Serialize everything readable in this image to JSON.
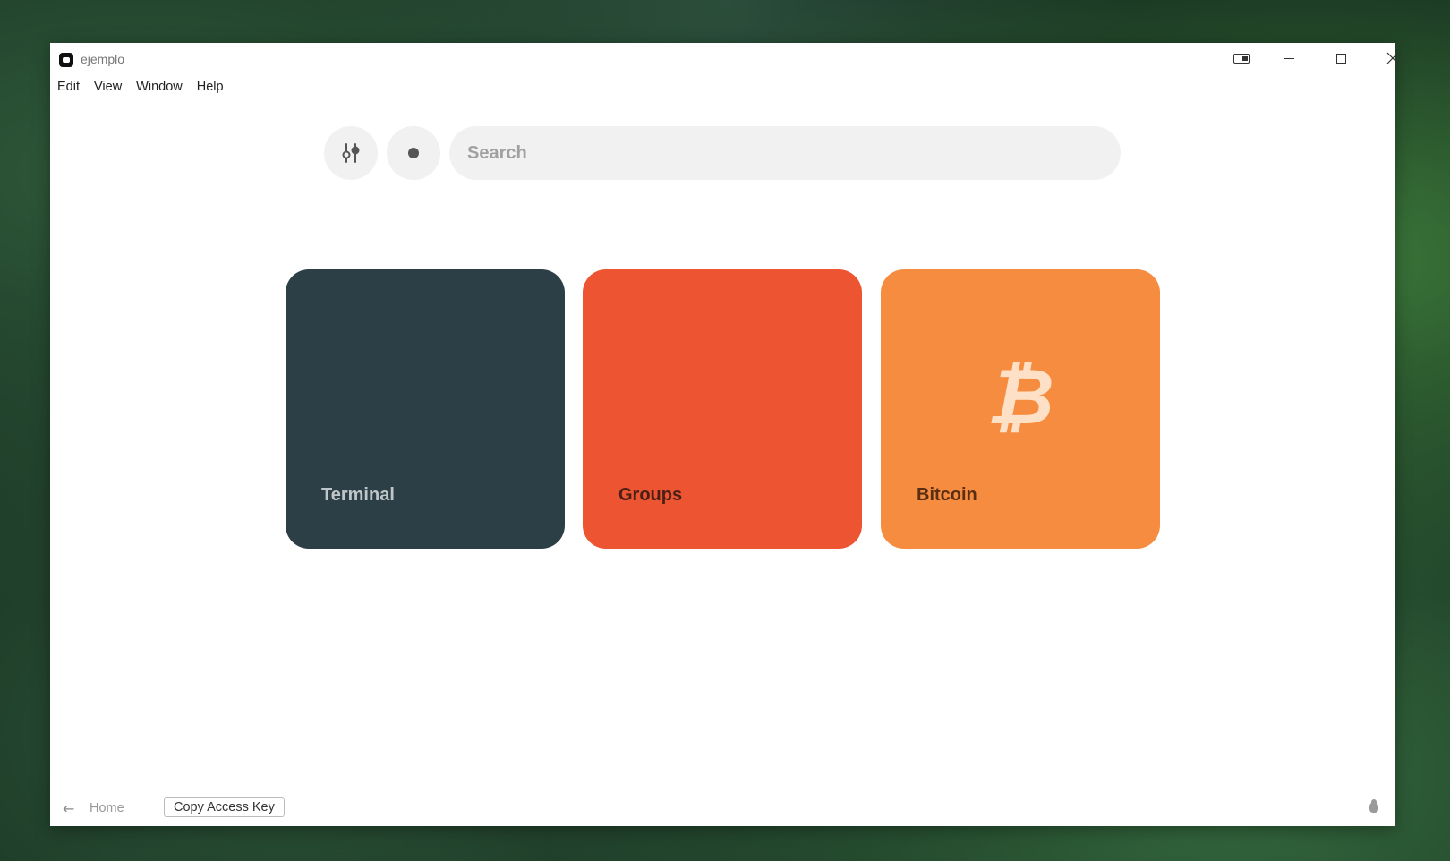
{
  "window": {
    "title": "ejemplo"
  },
  "menu": {
    "items": [
      "Edit",
      "View",
      "Window",
      "Help"
    ]
  },
  "toolbar": {
    "settings_icon": "sliders-icon",
    "status_icon": "dot-icon",
    "search_placeholder": "Search"
  },
  "tiles": [
    {
      "label": "Terminal",
      "color": "#2d3f46"
    },
    {
      "label": "Groups",
      "color": "#ec5432"
    },
    {
      "label": "Bitcoin",
      "color": "#f68c40",
      "icon": "bitcoin-icon",
      "glyph": "₿"
    }
  ],
  "footer": {
    "back_icon": "arrow-left-icon",
    "home_label": "Home",
    "copy_key_label": "Copy Access Key",
    "debug_icon": "bug-icon"
  }
}
